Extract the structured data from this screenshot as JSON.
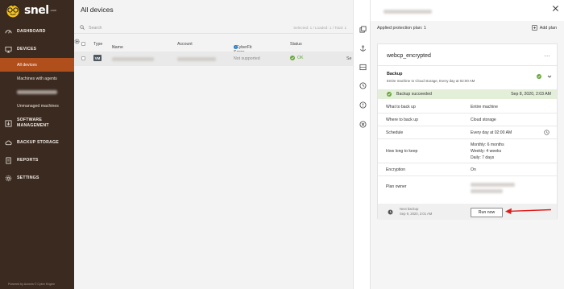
{
  "brand": {
    "name": "snel",
    "suffix": ".com",
    "footer": "Powered by Acronis © Cyber Engine"
  },
  "sidebar": {
    "dashboard": "DASHBOARD",
    "devices": "DEVICES",
    "devices_sub": [
      {
        "label": "All devices"
      },
      {
        "label": "Machines with agents"
      },
      {
        "label": ""
      },
      {
        "label": "Unmanaged machines"
      }
    ],
    "software_management": "SOFTWARE MANAGEMENT",
    "backup_storage": "BACKUP STORAGE",
    "reports": "REPORTS",
    "settings": "SETTINGS"
  },
  "devices": {
    "title": "All devices",
    "search_placeholder": "Search",
    "selection_info": "Selected: 1 / Loaded: 1 / Total: 1",
    "columns": {
      "type": "Type",
      "name": "Name",
      "account": "Account",
      "cyberfit": "#CyberFit Score",
      "status": "Status"
    },
    "rows": [
      {
        "type": "VM",
        "cyberfit": "Not supported",
        "status": "OK"
      }
    ]
  },
  "panel": {
    "applied_label": "Applied protection plan: 1",
    "add_plan_label": "Add plan",
    "plan_name": "webcp_encrypted",
    "more_label": "...",
    "backup_title": "Backup",
    "backup_desc": "Entire machine to Cloud storage, Every day at 02:00 AM",
    "status_text": "Backup succeeded",
    "status_time": "Sep 8, 2020, 2:03 AM",
    "details": {
      "what_key": "What to back up",
      "what_val": "Entire machine",
      "where_key": "Where to back up",
      "where_val": "Cloud storage",
      "schedule_key": "Schedule",
      "schedule_val": "Every day at 02:00 AM",
      "keep_key": "How long to keep",
      "keep_monthly": "Monthly: 6 months",
      "keep_weekly": "Weekly: 4 weeks",
      "keep_daily": "Daily: 7 days",
      "enc_key": "Encryption",
      "enc_val": "On",
      "owner_key": "Plan owner"
    },
    "next_backup_label": "Next backup",
    "next_backup_time": "Sep 9, 2020, 2:01 AM",
    "run_now_label": "Run now"
  },
  "colors": {
    "sidebar_bg": "#3b2a1f",
    "active_item": "#b14f1c",
    "ok_green": "#67a73a",
    "success_bg": "#e3efd8",
    "arrow_red": "#e01b1b"
  }
}
